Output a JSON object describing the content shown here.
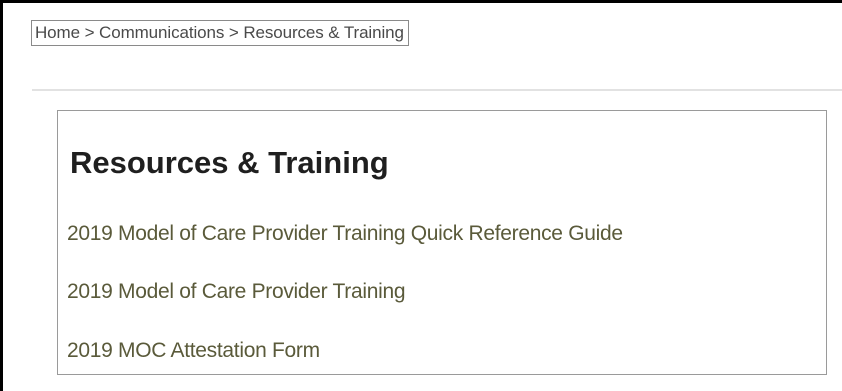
{
  "breadcrumb": {
    "items": [
      "Home",
      "Communications",
      "Resources & Training"
    ],
    "separator": ">"
  },
  "page": {
    "title": "Resources & Training"
  },
  "links": [
    {
      "label": "2019 Model of Care Provider Training Quick Reference Guide"
    },
    {
      "label": "2019 Model of Care Provider Training"
    },
    {
      "label": "2019 MOC Attestation Form"
    }
  ],
  "colors": {
    "link": "#5a5a3a",
    "title": "#1f1f1f",
    "breadcrumb_text": "#4a4a4a",
    "panel_border": "#9a9a9a"
  }
}
